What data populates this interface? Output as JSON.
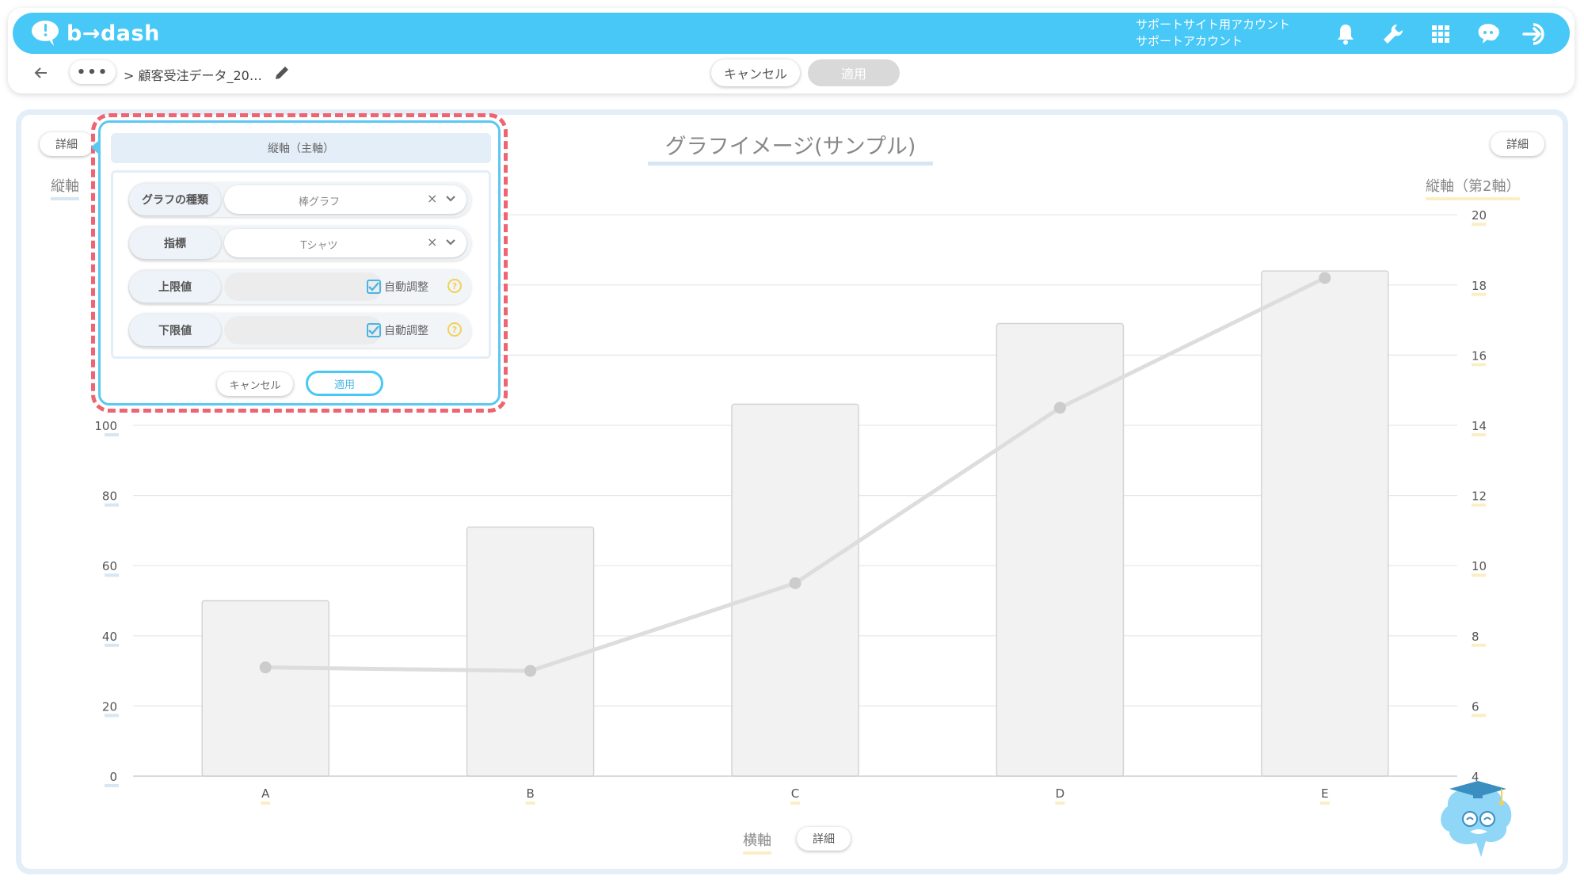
{
  "app": {
    "logo_text": "b→dash"
  },
  "header": {
    "account_line1": "サポートサイト用アカウント",
    "account_line2": "サポートアカウント",
    "icons": [
      "bell-icon",
      "wrench-icon",
      "apps-grid-icon",
      "chat-brain-icon",
      "logout-icon"
    ]
  },
  "subbar": {
    "more_label": "•••",
    "breadcrumb": "> 顧客受注データ_20…",
    "cancel_label": "キャンセル",
    "apply_label": "適用"
  },
  "chart_panel": {
    "title": "グラフイメージ(サンプル)",
    "left_axis_name": "縦軸",
    "right_axis_name": "縦軸（第2軸）",
    "x_axis_name": "横軸",
    "detail_label": "詳細"
  },
  "popup": {
    "title": "縦軸（主軸）",
    "rows": [
      {
        "label": "グラフの種類",
        "value": "棒グラフ"
      },
      {
        "label": "指標",
        "value": "Tシャツ"
      },
      {
        "label": "上限値",
        "checkbox_label": "自動調整",
        "checked": true
      },
      {
        "label": "下限値",
        "checkbox_label": "自動調整",
        "checked": true
      }
    ],
    "cancel_label": "キャンセル",
    "apply_label": "適用",
    "clear_glyph": "×",
    "help_glyph": "?"
  },
  "chart_data": {
    "type": "bar",
    "categories": [
      "A",
      "B",
      "C",
      "D",
      "E"
    ],
    "series": [
      {
        "type": "bar",
        "axis": "left",
        "values": [
          50,
          71,
          106,
          129,
          144
        ]
      },
      {
        "type": "line",
        "axis": "right",
        "values": [
          7.1,
          7.0,
          9.5,
          14.5,
          18.2
        ]
      }
    ],
    "ylim": [
      0,
      160
    ],
    "y_ticks": [
      0,
      20,
      40,
      60,
      80,
      100
    ],
    "y2lim": [
      4,
      20
    ],
    "y2_ticks": [
      4,
      6,
      8,
      10,
      12,
      14,
      16,
      18,
      20
    ],
    "grid": true,
    "colors": {
      "bar_fill": "#f2f2f2",
      "bar_stroke": "#d4d4d4",
      "line": "#dddddd",
      "point": "#cccccc",
      "grid": "#e6e6e6"
    }
  }
}
